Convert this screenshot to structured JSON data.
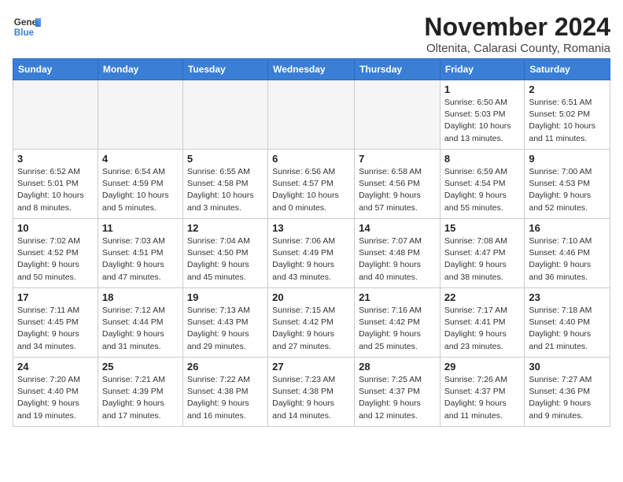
{
  "header": {
    "logo_general": "General",
    "logo_blue": "Blue",
    "month_title": "November 2024",
    "location": "Oltenita, Calarasi County, Romania"
  },
  "columns": [
    "Sunday",
    "Monday",
    "Tuesday",
    "Wednesday",
    "Thursday",
    "Friday",
    "Saturday"
  ],
  "weeks": [
    [
      {
        "day": "",
        "info": ""
      },
      {
        "day": "",
        "info": ""
      },
      {
        "day": "",
        "info": ""
      },
      {
        "day": "",
        "info": ""
      },
      {
        "day": "",
        "info": ""
      },
      {
        "day": "1",
        "info": "Sunrise: 6:50 AM\nSunset: 5:03 PM\nDaylight: 10 hours and 13 minutes."
      },
      {
        "day": "2",
        "info": "Sunrise: 6:51 AM\nSunset: 5:02 PM\nDaylight: 10 hours and 11 minutes."
      }
    ],
    [
      {
        "day": "3",
        "info": "Sunrise: 6:52 AM\nSunset: 5:01 PM\nDaylight: 10 hours and 8 minutes."
      },
      {
        "day": "4",
        "info": "Sunrise: 6:54 AM\nSunset: 4:59 PM\nDaylight: 10 hours and 5 minutes."
      },
      {
        "day": "5",
        "info": "Sunrise: 6:55 AM\nSunset: 4:58 PM\nDaylight: 10 hours and 3 minutes."
      },
      {
        "day": "6",
        "info": "Sunrise: 6:56 AM\nSunset: 4:57 PM\nDaylight: 10 hours and 0 minutes."
      },
      {
        "day": "7",
        "info": "Sunrise: 6:58 AM\nSunset: 4:56 PM\nDaylight: 9 hours and 57 minutes."
      },
      {
        "day": "8",
        "info": "Sunrise: 6:59 AM\nSunset: 4:54 PM\nDaylight: 9 hours and 55 minutes."
      },
      {
        "day": "9",
        "info": "Sunrise: 7:00 AM\nSunset: 4:53 PM\nDaylight: 9 hours and 52 minutes."
      }
    ],
    [
      {
        "day": "10",
        "info": "Sunrise: 7:02 AM\nSunset: 4:52 PM\nDaylight: 9 hours and 50 minutes."
      },
      {
        "day": "11",
        "info": "Sunrise: 7:03 AM\nSunset: 4:51 PM\nDaylight: 9 hours and 47 minutes."
      },
      {
        "day": "12",
        "info": "Sunrise: 7:04 AM\nSunset: 4:50 PM\nDaylight: 9 hours and 45 minutes."
      },
      {
        "day": "13",
        "info": "Sunrise: 7:06 AM\nSunset: 4:49 PM\nDaylight: 9 hours and 43 minutes."
      },
      {
        "day": "14",
        "info": "Sunrise: 7:07 AM\nSunset: 4:48 PM\nDaylight: 9 hours and 40 minutes."
      },
      {
        "day": "15",
        "info": "Sunrise: 7:08 AM\nSunset: 4:47 PM\nDaylight: 9 hours and 38 minutes."
      },
      {
        "day": "16",
        "info": "Sunrise: 7:10 AM\nSunset: 4:46 PM\nDaylight: 9 hours and 36 minutes."
      }
    ],
    [
      {
        "day": "17",
        "info": "Sunrise: 7:11 AM\nSunset: 4:45 PM\nDaylight: 9 hours and 34 minutes."
      },
      {
        "day": "18",
        "info": "Sunrise: 7:12 AM\nSunset: 4:44 PM\nDaylight: 9 hours and 31 minutes."
      },
      {
        "day": "19",
        "info": "Sunrise: 7:13 AM\nSunset: 4:43 PM\nDaylight: 9 hours and 29 minutes."
      },
      {
        "day": "20",
        "info": "Sunrise: 7:15 AM\nSunset: 4:42 PM\nDaylight: 9 hours and 27 minutes."
      },
      {
        "day": "21",
        "info": "Sunrise: 7:16 AM\nSunset: 4:42 PM\nDaylight: 9 hours and 25 minutes."
      },
      {
        "day": "22",
        "info": "Sunrise: 7:17 AM\nSunset: 4:41 PM\nDaylight: 9 hours and 23 minutes."
      },
      {
        "day": "23",
        "info": "Sunrise: 7:18 AM\nSunset: 4:40 PM\nDaylight: 9 hours and 21 minutes."
      }
    ],
    [
      {
        "day": "24",
        "info": "Sunrise: 7:20 AM\nSunset: 4:40 PM\nDaylight: 9 hours and 19 minutes."
      },
      {
        "day": "25",
        "info": "Sunrise: 7:21 AM\nSunset: 4:39 PM\nDaylight: 9 hours and 17 minutes."
      },
      {
        "day": "26",
        "info": "Sunrise: 7:22 AM\nSunset: 4:38 PM\nDaylight: 9 hours and 16 minutes."
      },
      {
        "day": "27",
        "info": "Sunrise: 7:23 AM\nSunset: 4:38 PM\nDaylight: 9 hours and 14 minutes."
      },
      {
        "day": "28",
        "info": "Sunrise: 7:25 AM\nSunset: 4:37 PM\nDaylight: 9 hours and 12 minutes."
      },
      {
        "day": "29",
        "info": "Sunrise: 7:26 AM\nSunset: 4:37 PM\nDaylight: 9 hours and 11 minutes."
      },
      {
        "day": "30",
        "info": "Sunrise: 7:27 AM\nSunset: 4:36 PM\nDaylight: 9 hours and 9 minutes."
      }
    ]
  ]
}
